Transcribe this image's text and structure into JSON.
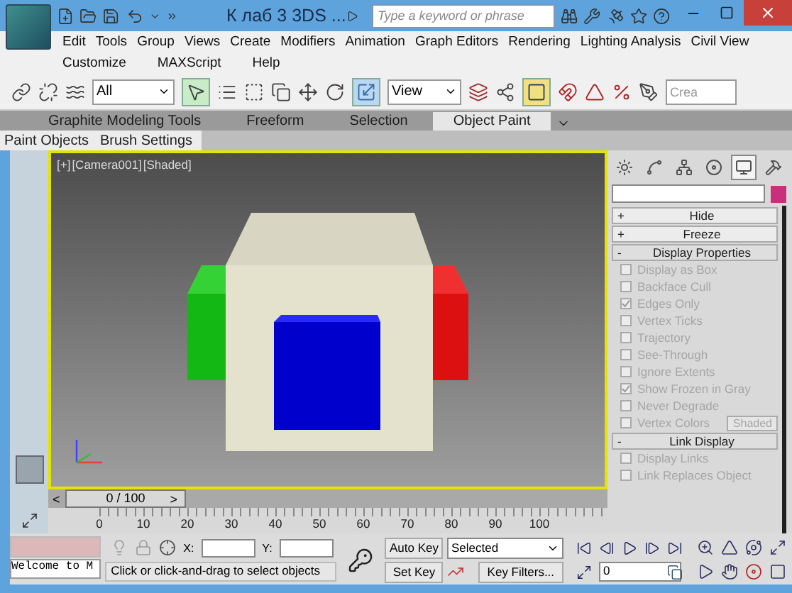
{
  "window": {
    "title": "К лаб 3 3DS ...",
    "search_placeholder": "Type a keyword or phrase"
  },
  "menu": {
    "rows": [
      {
        "items": [
          "Edit",
          "Tools",
          "Group",
          "Views",
          "Create",
          "Modifiers",
          "Animation",
          "Graph Editors",
          "Rendering",
          "Lighting Analysis",
          "Civil View"
        ]
      },
      {
        "items": [
          "Customize",
          "MAXScript",
          "Help"
        ]
      }
    ]
  },
  "toolbar": {
    "selection_filter": "All",
    "select_object_active": true,
    "scale_active": true,
    "snap_toggle_active": true,
    "reference_coordinate": "View",
    "named_selection_placeholder": "Crea"
  },
  "ribbon_tabs": [
    {
      "label": "Graphite Modeling Tools",
      "selected": false
    },
    {
      "label": "Freeform",
      "selected": false
    },
    {
      "label": "Selection",
      "selected": false
    },
    {
      "label": "Object Paint",
      "selected": true
    }
  ],
  "ribbon_subtabs": [
    {
      "label": "Paint Objects"
    },
    {
      "label": "Brush Settings"
    }
  ],
  "viewport": {
    "labels": [
      "[+]",
      "[Camera001]",
      "[Shaded]"
    ]
  },
  "command_panel": {
    "tabs": [
      {
        "selected": false
      },
      {
        "selected": false
      },
      {
        "selected": false
      },
      {
        "selected": false
      },
      {
        "selected": true
      },
      {
        "selected": false
      }
    ],
    "rollouts": [
      {
        "sign": "+",
        "title": "Hide",
        "expanded": false
      },
      {
        "sign": "+",
        "title": "Freeze",
        "expanded": false
      },
      {
        "sign": "-",
        "title": "Display Properties",
        "expanded": true,
        "options": [
          {
            "label": "Display as Box",
            "checked": false,
            "disabled": true
          },
          {
            "label": "Backface Cull",
            "checked": false,
            "disabled": true
          },
          {
            "label": "Edges Only",
            "checked": true,
            "disabled": true
          },
          {
            "label": "Vertex Ticks",
            "checked": false,
            "disabled": true
          },
          {
            "label": "Trajectory",
            "checked": false,
            "disabled": true
          },
          {
            "label": "See-Through",
            "checked": false,
            "disabled": true
          },
          {
            "label": "Ignore Extents",
            "checked": false,
            "disabled": true
          },
          {
            "label": "Show Frozen in Gray",
            "checked": true,
            "disabled": true
          },
          {
            "label": "Never Degrade",
            "checked": false,
            "disabled": true
          },
          {
            "label": "Vertex Colors",
            "checked": false,
            "disabled": true,
            "button": "Shaded"
          }
        ]
      },
      {
        "sign": "-",
        "title": "Link Display",
        "expanded": true,
        "options": [
          {
            "label": "Display Links",
            "checked": false,
            "disabled": true
          },
          {
            "label": "Link Replaces Object",
            "checked": false,
            "disabled": true
          }
        ]
      }
    ]
  },
  "time_slider": {
    "prev": "<",
    "position": "0 / 100",
    "level": 0,
    "next": ">",
    "ruler_labels": [
      "0",
      "10",
      "20",
      "30",
      "40",
      "50",
      "60",
      "70",
      "80",
      "90",
      "100"
    ]
  },
  "status": {
    "listener": "Welcome to M",
    "prompt": "Click or click-and-drag to select objects",
    "x_label": "X:",
    "y_label": "Y:",
    "auto_key": "Auto Key",
    "key_mode": "Selected",
    "set_key": "Set Key",
    "key_filters": "Key Filters...",
    "frame": "0"
  }
}
